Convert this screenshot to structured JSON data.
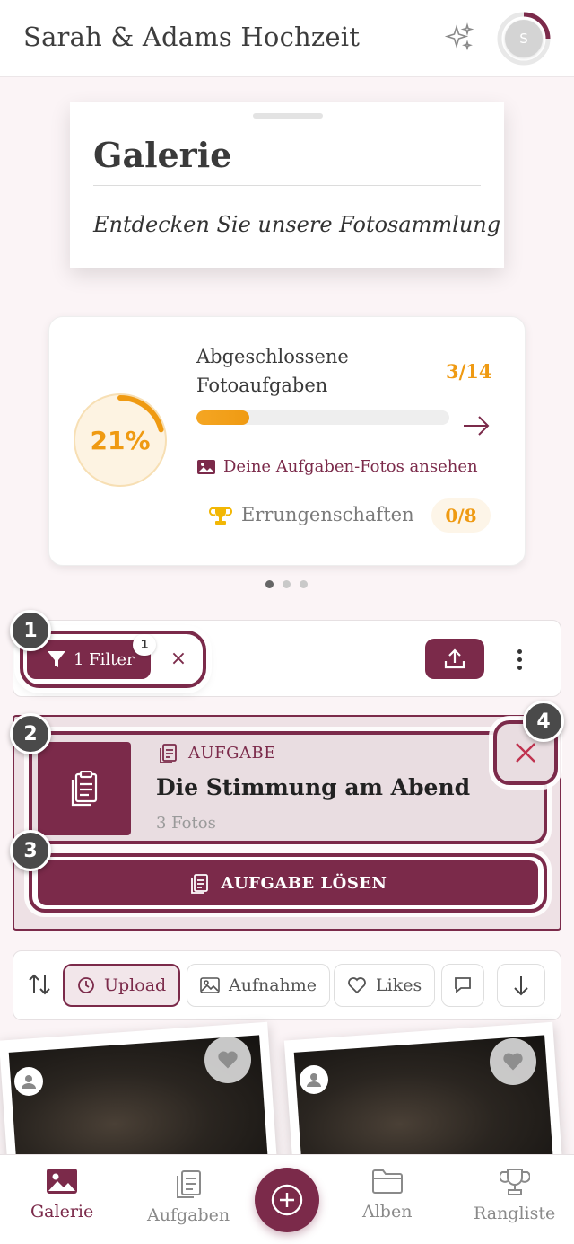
{
  "header": {
    "title": "Sarah & Adams Hochzeit",
    "avatar_initial": "S"
  },
  "gallery": {
    "title": "Galerie",
    "subtitle": "Entdecken Sie unsere Fotosammlung"
  },
  "progress": {
    "percent_label": "21%",
    "percent_value": 0.21,
    "title": "Abgeschlossene Fotoaufgaben",
    "count": "3/14",
    "photos_link": "Deine Aufgaben-Fotos ansehen",
    "achievements_label": "Errungenschaften",
    "achievements_count": "0/8"
  },
  "carousel": {
    "pages": 3,
    "active": 0
  },
  "filter": {
    "chip_label": "1 Filter",
    "badge": "1",
    "clear_symbol": "×"
  },
  "task": {
    "type_label": "AUFGABE",
    "title": "Die Stimmung am Abend",
    "photo_count": "3 Fotos",
    "solve_label": "AUFGABE LÖSEN"
  },
  "callouts": [
    "1",
    "2",
    "3",
    "4"
  ],
  "sort": {
    "chips": [
      {
        "label": "Upload",
        "icon": "clock-icon",
        "active": true
      },
      {
        "label": "Aufnahme",
        "icon": "image-icon",
        "active": false
      },
      {
        "label": "Likes",
        "icon": "heart-icon",
        "active": false
      },
      {
        "label": "",
        "icon": "comment-icon",
        "active": false
      }
    ]
  },
  "nav": {
    "items": [
      {
        "label": "Galerie",
        "icon": "gallery-icon",
        "active": true
      },
      {
        "label": "Aufgaben",
        "icon": "clipboard-icon",
        "active": false
      },
      {
        "label": "Alben",
        "icon": "folder-icon",
        "active": false
      },
      {
        "label": "Rangliste",
        "icon": "trophy-icon",
        "active": false
      }
    ]
  },
  "colors": {
    "brand": "#7b2a4a",
    "accent": "#ef9a12",
    "background": "#fbf4f6"
  }
}
